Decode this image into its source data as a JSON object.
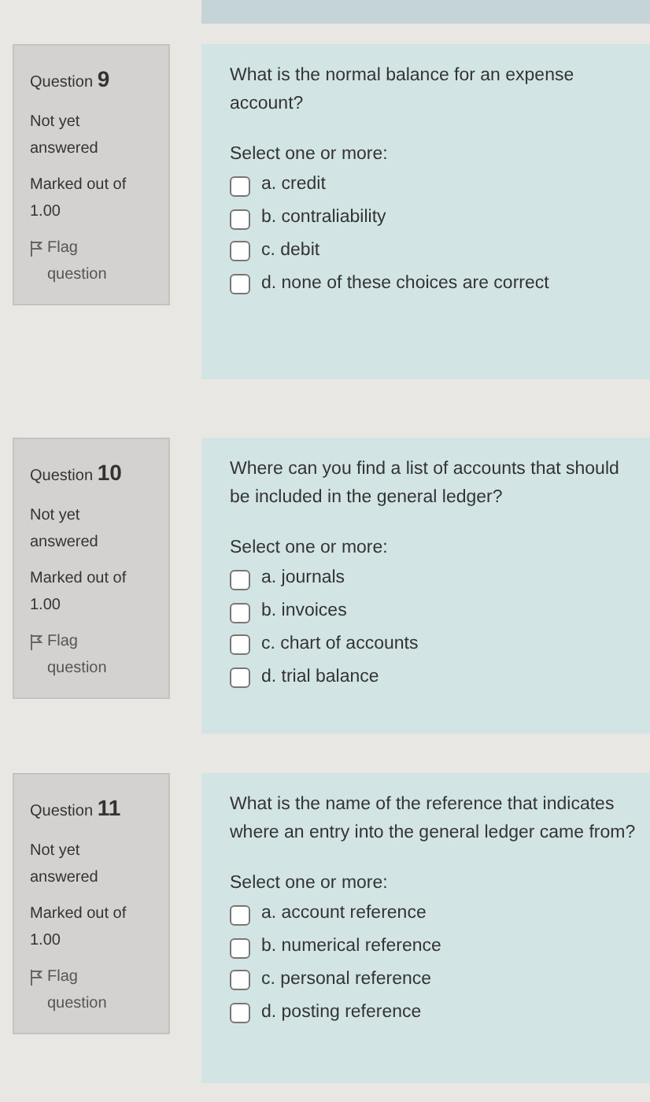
{
  "questions": [
    {
      "label": "Question",
      "number": "9",
      "status": "Not yet answered",
      "marks": "Marked out of 1.00",
      "flag": "Flag question",
      "text": "What is the normal balance for an expense account?",
      "prompt": "Select one or more:",
      "options": [
        {
          "text": "a. credit",
          "checked": false
        },
        {
          "text": "b. contraliability",
          "checked": false
        },
        {
          "text": "c. debit",
          "checked": false
        },
        {
          "text": "d. none of these choices are correct",
          "checked": false
        }
      ]
    },
    {
      "label": "Question",
      "number": "10",
      "status": "Not yet answered",
      "marks": "Marked out of 1.00",
      "flag": "Flag question",
      "text": "Where can you find a list of accounts that should be included in the general ledger?",
      "prompt": "Select one or more:",
      "options": [
        {
          "text": "a. journals",
          "checked": false
        },
        {
          "text": "b. invoices",
          "checked": false
        },
        {
          "text": "c. chart of accounts",
          "checked": false
        },
        {
          "text": "d. trial balance",
          "checked": false
        }
      ]
    },
    {
      "label": "Question",
      "number": "11",
      "status": "Not yet answered",
      "marks": "Marked out of 1.00",
      "flag": "Flag question",
      "text": "What is the name of the reference that indicates where an entry into the general ledger came from?",
      "prompt": "Select one or more:",
      "options": [
        {
          "text": "a. account reference",
          "checked": false
        },
        {
          "text": "b. numerical reference",
          "checked": false
        },
        {
          "text": "c. personal reference",
          "checked": false
        },
        {
          "text": "d. posting reference",
          "checked": false
        }
      ]
    }
  ]
}
